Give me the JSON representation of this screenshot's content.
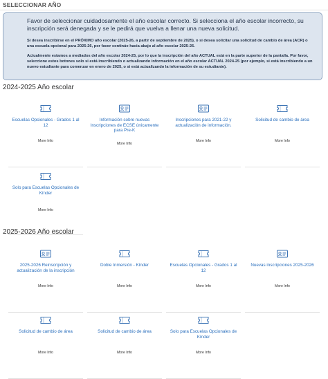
{
  "header": {
    "title": "SELECCIONAR AÑO"
  },
  "notice": {
    "lead": "Favor de seleccionar cuidadosamente el año escolar correcto. Si selecciona el año escolar incorrecto, su inscripción será denegada y se le pedirá que vuelva a llenar una nueva solicitud.",
    "p1": "Si desea inscribirse en el PRÓXIMO año escolar (2025-26, a partir de septiembre de 2025), o si desea solicitar una solicitud de cambio de área (ACR) o una escuela opcional para 2025-26, por favor continúe hacia abajo al año escolar 2025-26.",
    "p2": "Actualmente estamos a mediados del año escolar 2024-25, por lo que la inscripción del año ACTUAL está en la parte superior de la pantalla. Por favor, seleccione estos botones solo si está inscribiendo o actualizando información en el año escolar ACTUAL 2024-25 (por ejemplo, si está inscribiendo a un nuevo estudiante para comenzar en enero de 2025, o si está actualizando la información de su estudiante)."
  },
  "section_2024": {
    "title": "2024-2025 Año escolar",
    "tiles": [
      {
        "label": "Escuelas Opcionales - Grados 1 al 12",
        "more": "More Info",
        "icon": "ticket-icon"
      },
      {
        "label": "Información sobre nuevas Inscripciones de ECSE únicamente para Pre-K",
        "more": "More Info",
        "icon": "id-card-icon"
      },
      {
        "label": "Inscripciones para 2021-22 y actualización de información.",
        "more": "More Info",
        "icon": "id-card-icon"
      },
      {
        "label": "Solicitud de cambio de área",
        "more": "More Info",
        "icon": "ticket-icon"
      },
      {
        "label": "Solo para Escuelas Opcionales de Kínder",
        "more": "More Info",
        "icon": "ticket-icon"
      }
    ]
  },
  "section_2025": {
    "title": "2025-2026 Año escolar",
    "tiles": [
      {
        "label": "2025-2026 Reinscripción y actualización de la inscripción",
        "more": "More Info",
        "icon": "id-card-icon"
      },
      {
        "label": "Doble Inmersión - Kínder",
        "more": "More Info",
        "icon": "ticket-icon"
      },
      {
        "label": "Escuelas Opcionales - Grados 1 al 12",
        "more": "More Info",
        "icon": "ticket-icon"
      },
      {
        "label": "Nuevas inscripciones 2025-2026",
        "more": "More Info",
        "icon": "id-card-icon"
      },
      {
        "label": "Solicitud de cambio de área",
        "more": "More Info",
        "icon": "ticket-icon"
      },
      {
        "label": "Solicitud de cambio de área",
        "more": "More Info",
        "icon": "ticket-icon"
      },
      {
        "label": "Solo para Escuelas Opcionales de Kínder",
        "more": "More Info",
        "icon": "ticket-icon"
      }
    ]
  },
  "colors": {
    "link": "#2a6fbd",
    "notice_bg": "#dde5ef",
    "notice_border": "#8fa6c2",
    "icon": "#3d74b5"
  }
}
